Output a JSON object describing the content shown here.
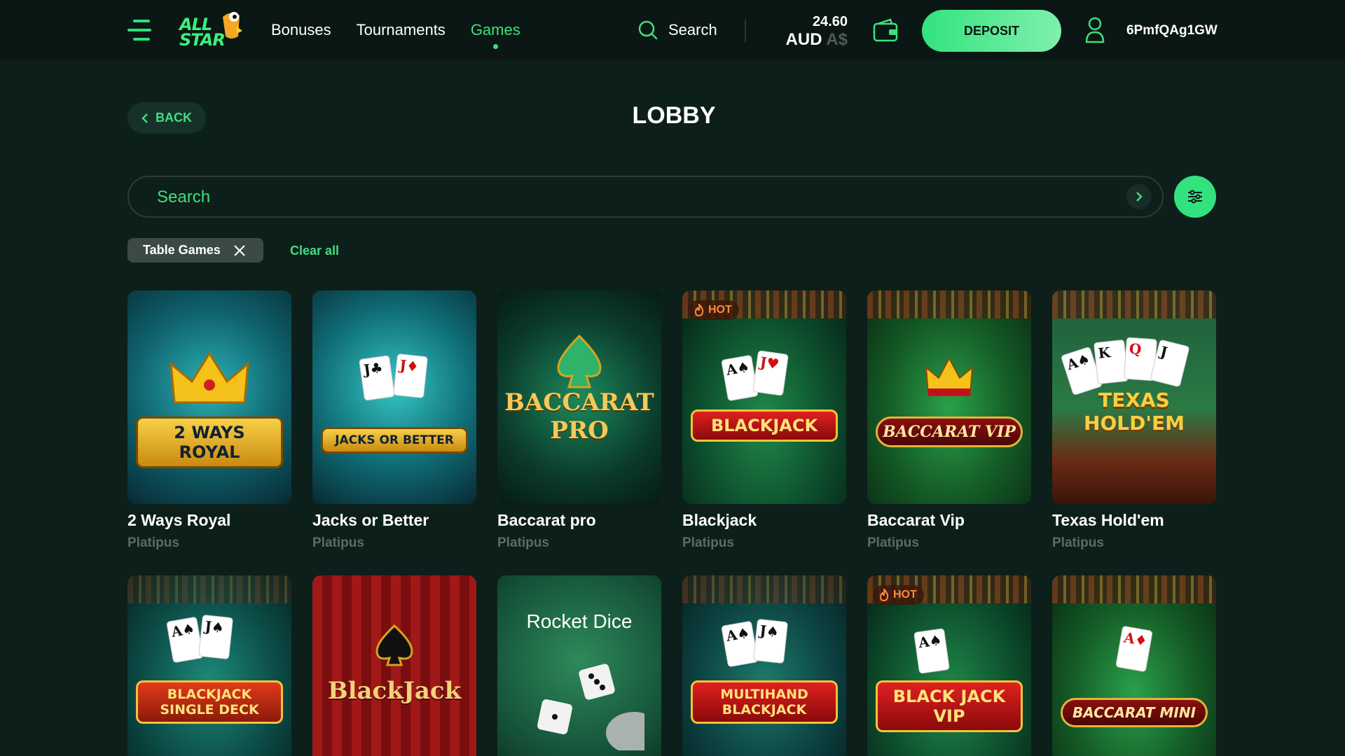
{
  "header": {
    "logo_line1": "ALL",
    "logo_line2": "STAR",
    "nav": [
      "Bonuses",
      "Tournaments",
      "Games"
    ],
    "active_nav": "Games",
    "search_label": "Search",
    "balance_amount": "24.60",
    "balance_currency": "AUD",
    "balance_symbol": "A$",
    "deposit_label": "DEPOSIT",
    "username": "6PmfQAg1GW"
  },
  "lobby": {
    "back_label": "BACK",
    "title": "LOBBY"
  },
  "search": {
    "placeholder": "Search"
  },
  "filters": {
    "chip_label": "Table Games",
    "clear_label": "Clear all"
  },
  "games": [
    {
      "name": "2 Ways Royal",
      "provider": "Platipus",
      "art_title": "2 WAYS ROYAL",
      "hot": false
    },
    {
      "name": "Jacks or Better",
      "provider": "Platipus",
      "art_title": "JACKS OR BETTER",
      "hot": false
    },
    {
      "name": "Baccarat pro",
      "provider": "Platipus",
      "art_title": "BACCARAT PRO",
      "hot": false
    },
    {
      "name": "Blackjack",
      "provider": "Platipus",
      "art_title": "BLACKJACK",
      "hot": true
    },
    {
      "name": "Baccarat Vip",
      "provider": "Platipus",
      "art_title": "BACCARAT VIP",
      "hot": false
    },
    {
      "name": "Texas Hold'em",
      "provider": "Platipus",
      "art_title": "TEXAS HOLD'EM",
      "hot": false
    },
    {
      "name": "",
      "provider": "",
      "art_title": "BLACKJACK SINGLE DECK",
      "hot": false
    },
    {
      "name": "",
      "provider": "",
      "art_title": "BlackJack",
      "hot": false
    },
    {
      "name": "",
      "provider": "",
      "art_title": "Rocket Dice",
      "hot": false
    },
    {
      "name": "",
      "provider": "",
      "art_title": "MULTIHAND BLACKJACK",
      "hot": false
    },
    {
      "name": "",
      "provider": "",
      "art_title": "BLACK JACK VIP",
      "hot": true
    },
    {
      "name": "",
      "provider": "",
      "art_title": "BACCARAT MINI",
      "hot": false
    }
  ],
  "hot_label": "HOT",
  "colors": {
    "accent": "#3ee07e",
    "background": "#0d1f1a",
    "header": "#0a1714",
    "muted_text": "#5b6b66"
  }
}
